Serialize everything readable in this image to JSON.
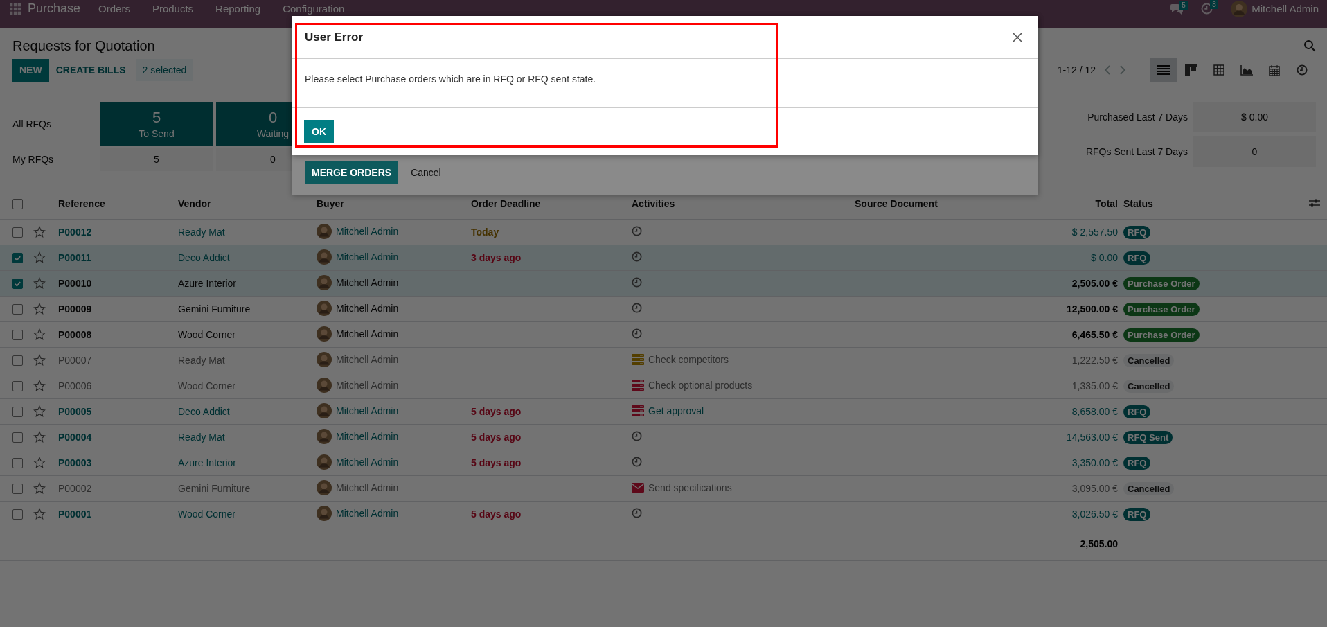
{
  "top_bar": {
    "app_name": "Purchase",
    "menu": [
      "Orders",
      "Products",
      "Reporting",
      "Configuration"
    ],
    "messages_count": "5",
    "activities_count": "8",
    "user": "Mitchell Admin"
  },
  "control_panel": {
    "title": "Requests for Quotation",
    "buttons": [
      {
        "label": "NEW",
        "kind": "primary"
      },
      {
        "label": "CREATE BILLS",
        "kind": "secondary"
      }
    ],
    "selection": "2 selected",
    "pager": "1-12 / 12",
    "views": [
      {
        "kind": "list",
        "selected": true
      },
      {
        "kind": "kanban",
        "selected": false
      },
      {
        "kind": "pivot",
        "selected": false
      },
      {
        "kind": "graph",
        "selected": false
      },
      {
        "kind": "calendar",
        "selected": false
      },
      {
        "kind": "activity",
        "selected": false
      }
    ]
  },
  "dashboard": {
    "row_labels": [
      "All RFQs",
      "My RFQs"
    ],
    "tiles": [
      {
        "value": "5",
        "label": "To Send",
        "mine": "5"
      },
      {
        "value": "0",
        "label": "Waiting",
        "mine": "0"
      }
    ],
    "stats": [
      {
        "label": "Purchased Last 7 Days",
        "value": "$ 0.00"
      },
      {
        "label": "RFQs Sent Last 7 Days",
        "value": "0"
      }
    ]
  },
  "table": {
    "select_all_checked": false,
    "columns": [
      "Reference",
      "Vendor",
      "Buyer",
      "Order Deadline",
      "Activities",
      "Source Document",
      "Total",
      "Status"
    ],
    "rows": [
      {
        "checked": false,
        "starred": false,
        "reference": "P00012",
        "vendor": "Ready Mat",
        "buyer": "Mitchell Admin",
        "deadline": {
          "text": "Today",
          "overdue": false
        },
        "activity": {
          "kind": "clock"
        },
        "total": "$ 2,557.50",
        "status": "RFQ",
        "kind": "rfq"
      },
      {
        "checked": true,
        "starred": false,
        "reference": "P00011",
        "vendor": "Deco Addict",
        "buyer": "Mitchell Admin",
        "deadline": {
          "text": "3 days ago",
          "overdue": true
        },
        "activity": {
          "kind": "clock"
        },
        "total": "$ 0.00",
        "status": "RFQ",
        "kind": "rfq"
      },
      {
        "checked": true,
        "starred": false,
        "reference": "P00010",
        "vendor": "Azure Interior",
        "buyer": "Mitchell Admin",
        "activity": {
          "kind": "clock"
        },
        "total": "2,505.00 €",
        "status": "Purchase Order",
        "kind": "purchase"
      },
      {
        "checked": false,
        "starred": false,
        "reference": "P00009",
        "vendor": "Gemini Furniture",
        "buyer": "Mitchell Admin",
        "activity": {
          "kind": "clock"
        },
        "total": "12,500.00 €",
        "status": "Purchase Order",
        "kind": "purchase"
      },
      {
        "checked": false,
        "starred": false,
        "reference": "P00008",
        "vendor": "Wood Corner",
        "buyer": "Mitchell Admin",
        "activity": {
          "kind": "clock"
        },
        "total": "6,465.50 €",
        "status": "Purchase Order",
        "kind": "purchase"
      },
      {
        "checked": false,
        "starred": false,
        "reference": "P00007",
        "vendor": "Ready Mat",
        "buyer": "Mitchell Admin",
        "activity": {
          "kind": "todo",
          "overdue": false,
          "text": "Check competitors"
        },
        "total": "1,222.50 €",
        "status": "Cancelled",
        "kind": "cancel"
      },
      {
        "checked": false,
        "starred": false,
        "reference": "P00006",
        "vendor": "Wood Corner",
        "buyer": "Mitchell Admin",
        "activity": {
          "kind": "todo",
          "overdue": true,
          "text": "Check optional products"
        },
        "total": "1,335.00 €",
        "status": "Cancelled",
        "kind": "cancel"
      },
      {
        "checked": false,
        "starred": false,
        "reference": "P00005",
        "vendor": "Deco Addict",
        "buyer": "Mitchell Admin",
        "deadline": {
          "text": "5 days ago",
          "overdue": true
        },
        "activity": {
          "kind": "todo",
          "overdue": true,
          "text": "Get approval"
        },
        "total": "8,658.00 €",
        "status": "RFQ",
        "kind": "rfq"
      },
      {
        "checked": false,
        "starred": false,
        "reference": "P00004",
        "vendor": "Ready Mat",
        "buyer": "Mitchell Admin",
        "deadline": {
          "text": "5 days ago",
          "overdue": true
        },
        "activity": {
          "kind": "clock"
        },
        "total": "14,563.00 €",
        "status": "RFQ Sent",
        "kind": "rfq"
      },
      {
        "checked": false,
        "starred": false,
        "reference": "P00003",
        "vendor": "Azure Interior",
        "buyer": "Mitchell Admin",
        "deadline": {
          "text": "5 days ago",
          "overdue": true
        },
        "activity": {
          "kind": "clock"
        },
        "total": "3,350.00 €",
        "status": "RFQ",
        "kind": "rfq"
      },
      {
        "checked": false,
        "starred": false,
        "reference": "P00002",
        "vendor": "Gemini Furniture",
        "buyer": "Mitchell Admin",
        "activity": {
          "kind": "email",
          "overdue": true,
          "text": "Send specifications"
        },
        "total": "3,095.00 €",
        "status": "Cancelled",
        "kind": "cancel"
      },
      {
        "checked": false,
        "starred": false,
        "reference": "P00001",
        "vendor": "Wood Corner",
        "buyer": "Mitchell Admin",
        "deadline": {
          "text": "5 days ago",
          "overdue": true
        },
        "activity": {
          "kind": "clock"
        },
        "total": "3,026.50 €",
        "status": "RFQ",
        "kind": "rfq"
      }
    ],
    "footer_total": "2,505.00"
  },
  "merge_dialog": {
    "buttons": [
      {
        "label": "MERGE ORDERS",
        "kind": "primary"
      },
      {
        "label": "Cancel",
        "kind": "link"
      }
    ]
  },
  "error_dialog": {
    "title": "User Error",
    "message": "Please select Purchase orders which are in RFQ or RFQ sent state.",
    "button": "OK",
    "highlighted": true
  }
}
